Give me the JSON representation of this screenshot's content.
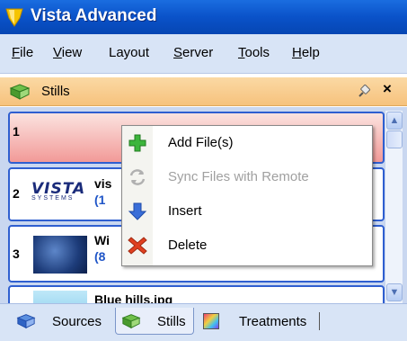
{
  "window": {
    "title": "Vista Advanced"
  },
  "menu": [
    {
      "label": "File",
      "acc": "F",
      "rest": "ile"
    },
    {
      "label": "View",
      "acc": "V",
      "rest": "iew"
    },
    {
      "label": "Layout",
      "acc": "",
      "rest": "Layout"
    },
    {
      "label": "Server",
      "acc": "S",
      "rest": "erver"
    },
    {
      "label": "Tools",
      "acc": "T",
      "rest": "ools"
    },
    {
      "label": "Help",
      "acc": "H",
      "rest": "elp"
    }
  ],
  "panel": {
    "title": "Stills",
    "close": "×"
  },
  "items": [
    {
      "num": "1",
      "name": "",
      "sub": ""
    },
    {
      "num": "2",
      "name": "vis",
      "sub": "(1",
      "logo": "VISTA",
      "logo_sub": "SYSTEMS"
    },
    {
      "num": "3",
      "name": "Wi",
      "sub": "(8"
    },
    {
      "num": "",
      "name": "Blue hills.jpg",
      "sub": ""
    }
  ],
  "context_menu": [
    {
      "label": "Add File(s)",
      "icon": "plus-icon",
      "enabled": true
    },
    {
      "label": "Sync Files with Remote",
      "icon": "sync-icon",
      "enabled": false
    },
    {
      "label": "Insert",
      "icon": "down-arrow-icon",
      "enabled": true
    },
    {
      "label": "Delete",
      "icon": "delete-x-icon",
      "enabled": true
    }
  ],
  "tabs": [
    {
      "label": "Sources",
      "icon": "book-icon"
    },
    {
      "label": "Stills",
      "icon": "book-icon",
      "active": true
    },
    {
      "label": "Treatments",
      "icon": "treatments-icon"
    }
  ],
  "colors": {
    "titlebar": "#0a52c9",
    "menubar": "#d8e4f6",
    "panel_header": "#f6c27d",
    "selected_item": "#f2a0a0",
    "accent_blue": "#1f55c7"
  }
}
